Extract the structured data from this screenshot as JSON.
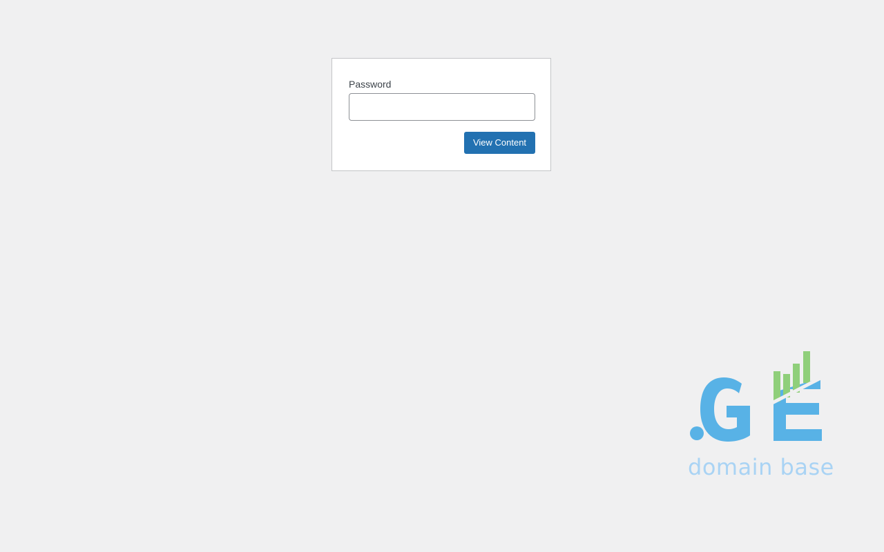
{
  "form": {
    "password_label": "Password",
    "password_value": "",
    "submit_label": "View Content"
  },
  "brand": {
    "logo_text": ".GE",
    "tagline": "domain base",
    "colors": {
      "primary": "#58b2e6",
      "accent": "#8fcf7a",
      "tagline": "#a9d3f4"
    }
  },
  "colors": {
    "page_background": "#f0f0f1",
    "button": "#2271b1"
  }
}
